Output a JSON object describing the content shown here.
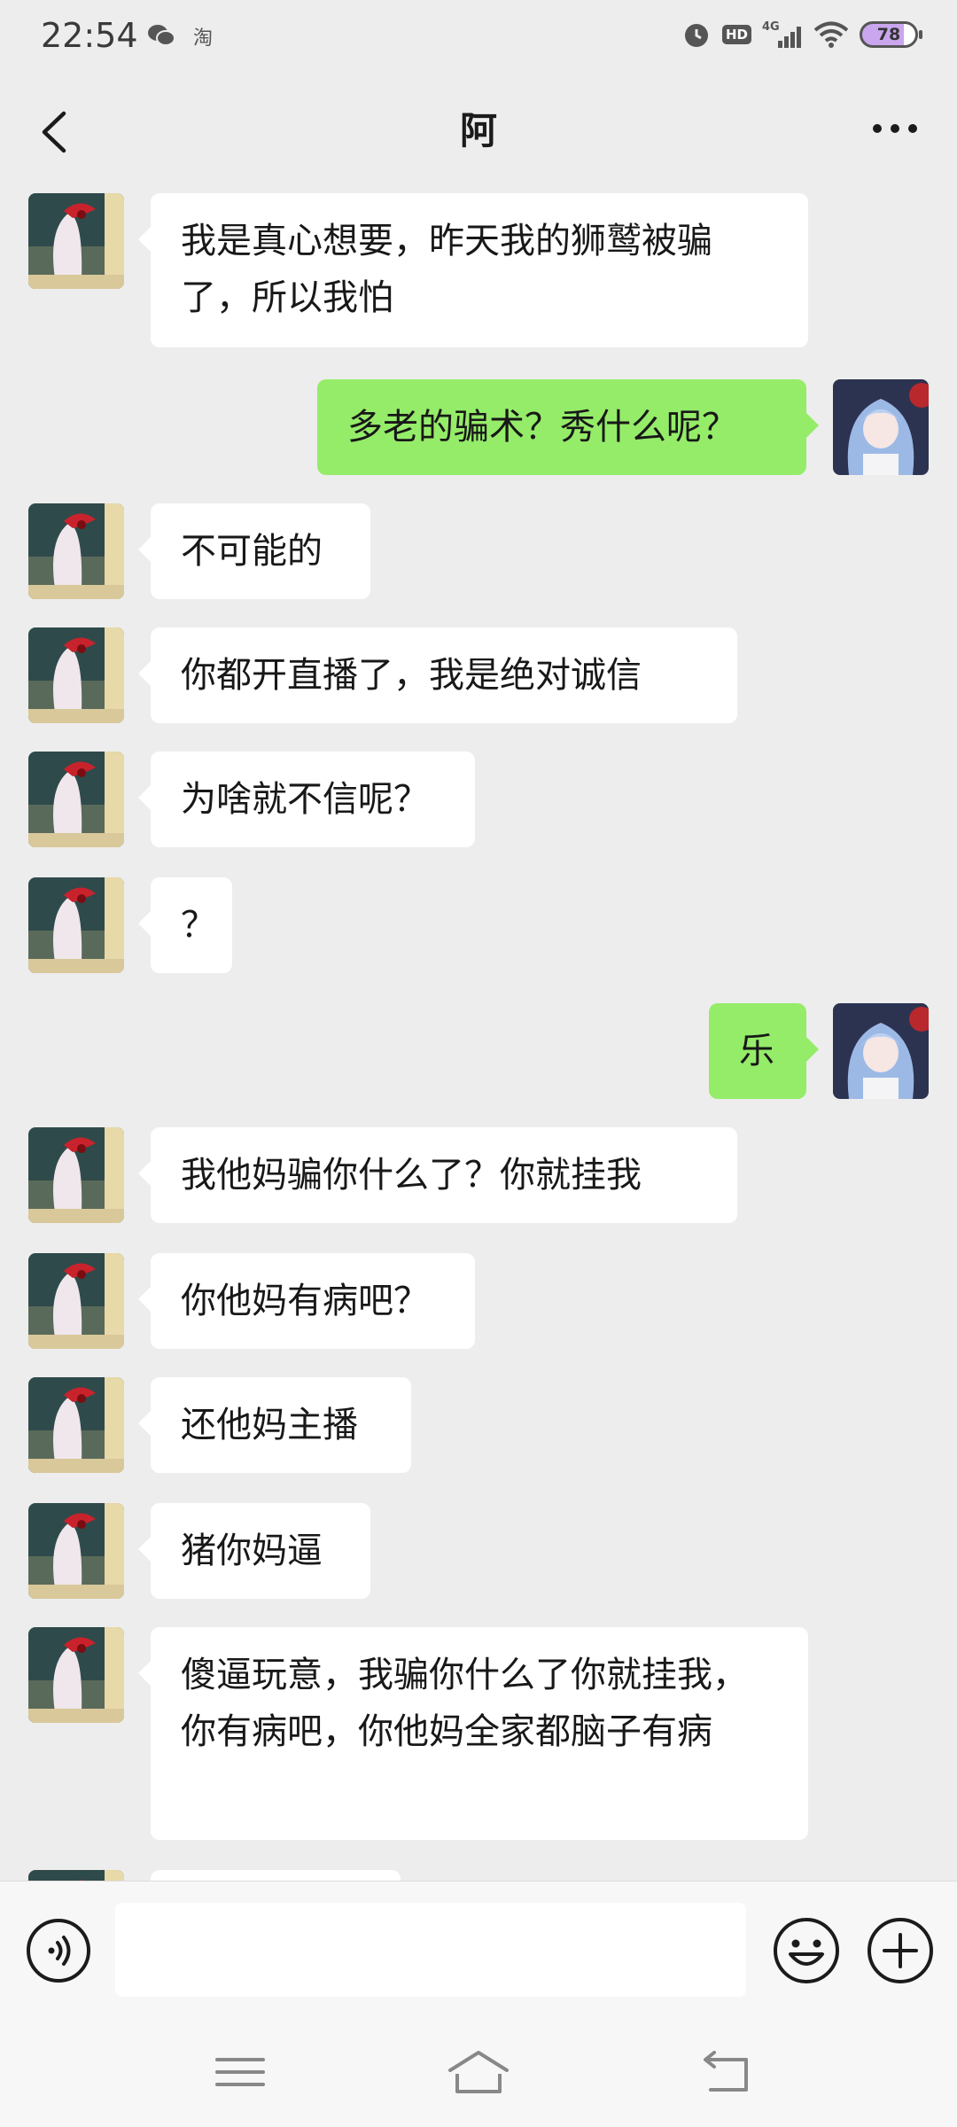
{
  "status": {
    "time": "22:54",
    "battery": "78",
    "network": "4G",
    "hd": "HD"
  },
  "header": {
    "title": "阿"
  },
  "messages": [
    {
      "side": "left",
      "text": "我是真心想要，昨天我的狮鹫被骗了，所以我怕"
    },
    {
      "side": "right",
      "text": "多老的骗术？秀什么呢？"
    },
    {
      "side": "left",
      "text": "不可能的"
    },
    {
      "side": "left",
      "text": "你都开直播了，我是绝对诚信"
    },
    {
      "side": "left",
      "text": "为啥就不信呢？"
    },
    {
      "side": "left",
      "text": "？"
    },
    {
      "side": "right",
      "text": "乐"
    },
    {
      "side": "left",
      "text": "我他妈骗你什么了？你就挂我"
    },
    {
      "side": "left",
      "text": "你他妈有病吧？"
    },
    {
      "side": "left",
      "text": "还他妈主播"
    },
    {
      "side": "left",
      "text": "猪你妈逼"
    },
    {
      "side": "left",
      "text": "傻逼玩意，我骗你什么了你就挂我，你有病吧，你他妈全家都脑子有病"
    },
    {
      "side": "left",
      "text": ""
    }
  ],
  "input": {
    "value": "",
    "placeholder": ""
  },
  "icons": {
    "back": "chevron-left-icon",
    "more": "more-dots-icon",
    "voice": "voice-icon",
    "emoji": "emoji-icon",
    "plus": "plus-icon",
    "menu": "menu-icon",
    "home": "home-icon",
    "return": "return-icon"
  },
  "colors": {
    "background": "#ededed",
    "bubble_self": "#95ec69",
    "bubble_other": "#ffffff"
  }
}
